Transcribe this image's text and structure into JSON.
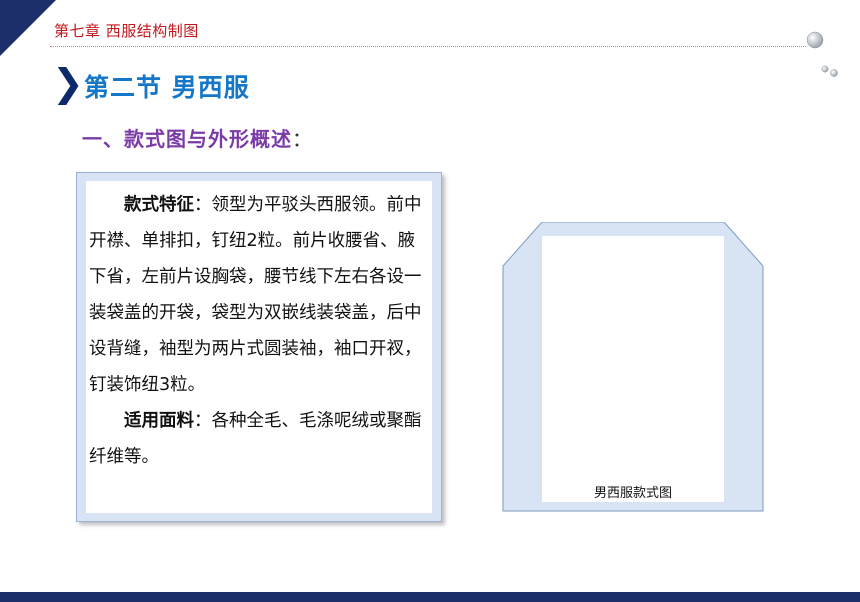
{
  "header": {
    "chapter": "第七章  西服结构制图"
  },
  "section": {
    "chevron": "❯",
    "title": "第二节  男西服",
    "subtitle_main": "一、款式图与外形概述",
    "subtitle_colon": "："
  },
  "description": {
    "style_label": "款式特征",
    "style_colon": "：",
    "style_text": "领型为平驳头西服领。前中开襟、单排扣，钉纽2粒。前片收腰省、腋下省，左前片设胸袋，腰节线下左右各设一装袋盖的开袋，袋型为双嵌线装袋盖，后中设背缝，袖型为两片式圆装袖，袖口开衩，钉装饰纽3粒。",
    "fabric_label": "适用面料",
    "fabric_colon": "：",
    "fabric_text": "各种全毛、毛涤呢绒或聚酯纤维等。"
  },
  "figure": {
    "caption": "男西服款式图"
  },
  "colors": {
    "navy": "#1d2f6b",
    "chapter_red": "#c0161c",
    "section_blue": "#1577c8",
    "subtitle_purple": "#7b3ba6",
    "panel_blue": "#d8e4f3"
  }
}
